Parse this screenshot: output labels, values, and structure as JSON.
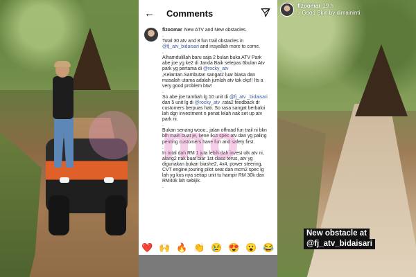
{
  "comments_screen": {
    "title": "Comments",
    "back_icon": "arrow-left-icon",
    "send_icon": "send-icon",
    "post": {
      "username": "fizoomar",
      "p1": "New ATV and New obstacles.",
      "p2_a": "Total 30 atv and 8 fun trail obstacles in ",
      "p2_tag": "@fj_atv_bidaisari",
      "p2_b": " and insyallah more to come.",
      "p3_a": "Alhamdulillah baru saja 2 bulan buka ATV Park abe joe yg ke2 di Janda Baik selepas 6bulan Atv park yg pertama di ",
      "p3_tag": "@rocky_atv",
      "p3_b": " ,Kelantan.Sambutan sangat2 luar biasa dan masalah utama adalah jumlah atv tak ckp!! Its a very good problem btw!",
      "p4_a": "So abe joe tambah lg 10 unit di ",
      "p4_tag1": "@fj_atv _bidaisari",
      "p4_b": " dan 5 unit lg di ",
      "p4_tag2": "@rocky_atv",
      "p4_c": " .rata2 feedback dr customers berpuas hati. So rasa sangat berbaloi lah dgn investment n penat lelah nak set up atv park ni.",
      "p5": "Bukan senang wooo.. jalan offroad fun trail ni bkn blh main buat je, kene ikut spec atv dan yg paling penting customers have fun and safety first.",
      "p6": "In total dah RM 1 juta lebih dah invest utk atv ni, alang2 nak buat biar 1st class terus, atv yg digunakan bukan biashe2, 4x4, power steering, CVT engine,touring pilot seat dan mcm2 spec lg lah yg kos nya setiap unit tu hampir RM 30k dan RM40k lah sebijik.",
      "dot": "."
    },
    "reactions": [
      "❤️",
      "🙌",
      "🔥",
      "👏",
      "😢",
      "😍",
      "😮",
      "😂"
    ]
  },
  "watermark": "mo",
  "story": {
    "username": "fizoomar",
    "time": "19 h",
    "music": "♪ Good Skin by dimaininti",
    "caption_line1": "New obstacle at",
    "caption_line2": "@fj_atv_bidaisari"
  }
}
